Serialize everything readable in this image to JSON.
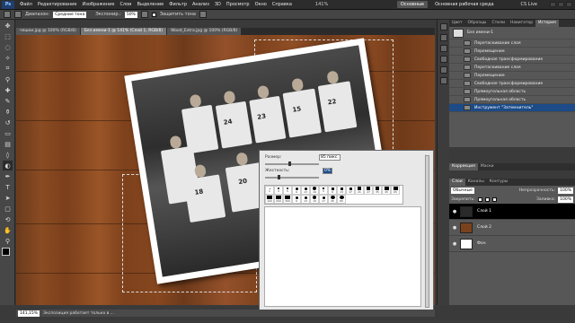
{
  "app": {
    "logo": "Ps",
    "menu": [
      "Файл",
      "Редактирование",
      "Изображение",
      "Слои",
      "Выделение",
      "Фильтр",
      "Анализ",
      "3D",
      "Просмотр",
      "Окно",
      "Справка"
    ],
    "zoom": "141%",
    "workspace_button": "Основные",
    "workspace_name": "Основная рабочая среда",
    "cs_live": "CS Live"
  },
  "options": {
    "mode_label": "Диапазон:",
    "mode_value": "Средние тона",
    "exposure_label": "Экспонир.:",
    "exposure_value": "50%",
    "protect_label": "Защитить тона"
  },
  "tabs": [
    {
      "label": "чешки.jpg @ 100% (RGB/8)"
    },
    {
      "label": "Без имени-1 @ 141% (Слой 1, RGB/8)"
    },
    {
      "label": "Wood_Extra.jpg @ 100% (RGB/8)"
    }
  ],
  "photo": {
    "jersey_numbers": [
      "24",
      "23",
      "15",
      "18",
      "22",
      "20"
    ]
  },
  "brush_panel": {
    "size_label": "Размер:",
    "size_value": "85 пикс.",
    "hardness_label": "Жесткость:",
    "hardness_value": "0%",
    "brush_presets": [
      "1",
      "3",
      "5",
      "9",
      "13",
      "19",
      "5",
      "9",
      "13",
      "17",
      "21",
      "27",
      "35",
      "45",
      "65",
      "100",
      "200",
      "300",
      "9",
      "13",
      "19",
      "17",
      "45",
      "65"
    ]
  },
  "history_panel": {
    "tabs": [
      "Цвет",
      "Образцы",
      "Стили",
      "Навигатор",
      "История"
    ],
    "snapshot": "Без имени-1",
    "items": [
      "Перетаскивание слоя",
      "Перемещение",
      "Свободное трансформирование",
      "Перетаскивание слоя",
      "Перемещение",
      "Свободное трансформирование",
      "Прямоугольная область",
      "Прямоугольная область",
      "Инструмент \"Затемнитель\""
    ]
  },
  "layers_panel": {
    "tabs": [
      "Коррекция",
      "Маски"
    ],
    "subtabs": [
      "Слои",
      "Каналы",
      "Контуры"
    ],
    "blend_mode": "Обычные",
    "opacity_label": "Непрозрачность:",
    "opacity_value": "100%",
    "lock_label": "Закрепить:",
    "fill_label": "Заливка:",
    "fill_value": "100%",
    "layers": [
      {
        "name": "Слой 1",
        "active": true,
        "thumb_color": "#2a2a2a"
      },
      {
        "name": "Слой 2",
        "active": false,
        "thumb_color": "#7a421c"
      },
      {
        "name": "Фон",
        "active": false,
        "thumb_color": "#ffffff"
      }
    ]
  },
  "status": {
    "zoom": "141,15%",
    "message": "Экспозиция работает только в ..."
  }
}
